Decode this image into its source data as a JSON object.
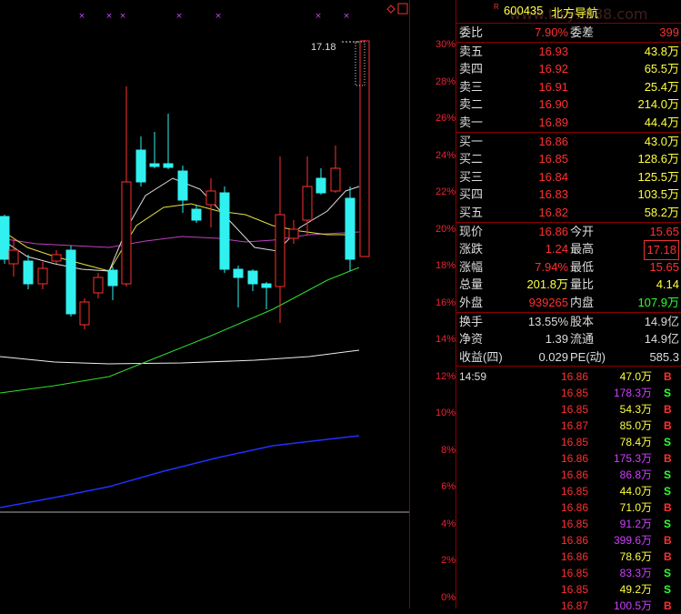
{
  "stock": {
    "code": "600435",
    "name": "北方导航",
    "marker": "R"
  },
  "watermark": "www.ttsyx888.com",
  "axis_labels": [
    "30%",
    "28%",
    "26%",
    "24%",
    "22%",
    "20%",
    "18%",
    "16%",
    "14%",
    "12%",
    "10%",
    "8%",
    "6%",
    "4%",
    "2%",
    "0%"
  ],
  "price_label": "17.18",
  "top_row": {
    "l1": "委比",
    "v1": "7.90%",
    "l2": "委差",
    "v2": "399"
  },
  "asks": [
    {
      "label": "卖五",
      "price": "16.93",
      "vol": "43.8万"
    },
    {
      "label": "卖四",
      "price": "16.92",
      "vol": "65.5万"
    },
    {
      "label": "卖三",
      "price": "16.91",
      "vol": "25.4万"
    },
    {
      "label": "卖二",
      "price": "16.90",
      "vol": "214.0万"
    },
    {
      "label": "卖一",
      "price": "16.89",
      "vol": "44.4万"
    }
  ],
  "bids": [
    {
      "label": "买一",
      "price": "16.86",
      "vol": "43.0万"
    },
    {
      "label": "买二",
      "price": "16.85",
      "vol": "128.6万"
    },
    {
      "label": "买三",
      "price": "16.84",
      "vol": "125.5万"
    },
    {
      "label": "买四",
      "price": "16.83",
      "vol": "103.5万"
    },
    {
      "label": "买五",
      "price": "16.82",
      "vol": "58.2万"
    }
  ],
  "stats": [
    {
      "l1": "现价",
      "v1": "16.86",
      "l2": "今开",
      "v2": "15.65"
    },
    {
      "l1": "涨跌",
      "v1": "1.24",
      "l2": "最高",
      "v2": "17.18"
    },
    {
      "l1": "涨幅",
      "v1": "7.94%",
      "l2": "最低",
      "v2": "15.65"
    },
    {
      "l1": "总量",
      "v1": "201.8万",
      "l2": "量比",
      "v2": "4.14"
    },
    {
      "l1": "外盘",
      "v1": "939265",
      "l2": "内盘",
      "v2": "107.9万"
    }
  ],
  "stats2": [
    {
      "l1": "换手",
      "v1": "13.55%",
      "l2": "股本",
      "v2": "14.9亿"
    },
    {
      "l1": "净资",
      "v1": "1.39",
      "l2": "流通",
      "v2": "14.9亿"
    },
    {
      "l1": "收益(四)",
      "v1": "0.029",
      "l2": "PE(动)",
      "v2": "585.3"
    }
  ],
  "ticks": [
    {
      "time": "14:59",
      "price": "16.86",
      "vol": "47.0万",
      "flag": "B"
    },
    {
      "time": "",
      "price": "16.85",
      "vol": "178.3万",
      "flag": "S"
    },
    {
      "time": "",
      "price": "16.85",
      "vol": "54.3万",
      "flag": "B"
    },
    {
      "time": "",
      "price": "16.87",
      "vol": "85.0万",
      "flag": "B"
    },
    {
      "time": "",
      "price": "16.85",
      "vol": "78.4万",
      "flag": "S"
    },
    {
      "time": "",
      "price": "16.86",
      "vol": "175.3万",
      "flag": "B"
    },
    {
      "time": "",
      "price": "16.86",
      "vol": "86.8万",
      "flag": "S"
    },
    {
      "time": "",
      "price": "16.85",
      "vol": "44.0万",
      "flag": "S"
    },
    {
      "time": "",
      "price": "16.86",
      "vol": "71.0万",
      "flag": "B"
    },
    {
      "time": "",
      "price": "16.85",
      "vol": "91.2万",
      "flag": "S"
    },
    {
      "time": "",
      "price": "16.86",
      "vol": "399.6万",
      "flag": "B"
    },
    {
      "time": "",
      "price": "16.86",
      "vol": "78.6万",
      "flag": "B"
    },
    {
      "time": "",
      "price": "16.85",
      "vol": "83.3万",
      "flag": "S"
    },
    {
      "time": "",
      "price": "16.85",
      "vol": "49.2万",
      "flag": "S"
    },
    {
      "time": "",
      "price": "16.87",
      "vol": "100.5万",
      "flag": "B"
    }
  ]
}
